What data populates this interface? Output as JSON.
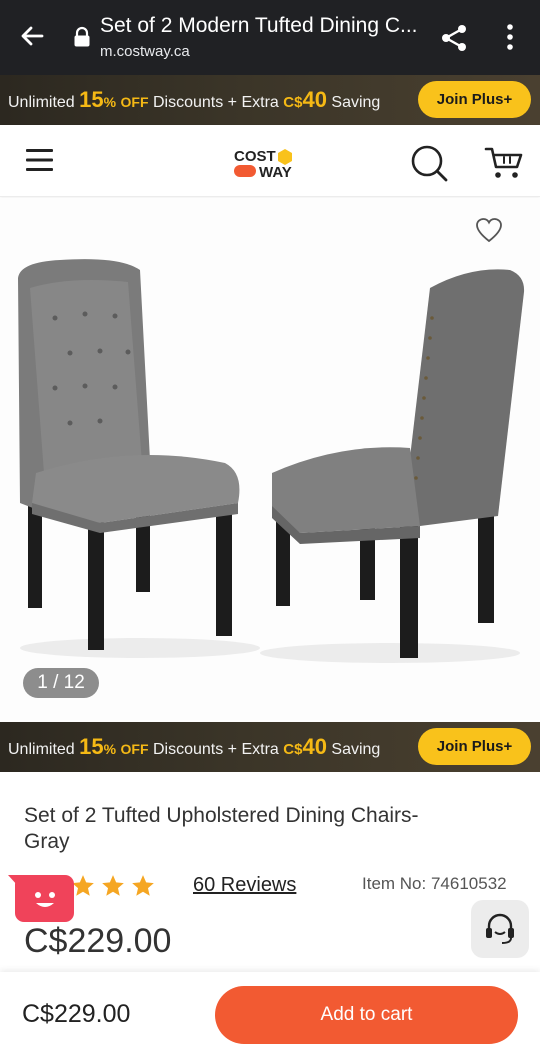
{
  "browser": {
    "title": "Set of 2 Modern Tufted Dining C...",
    "url": "m.costway.ca"
  },
  "promo": {
    "text_unlimited": "Unlimited",
    "percent": "15",
    "percent_suffix": "%",
    "off": "OFF",
    "text_discounts": "Discounts + Extra",
    "currency": "C$",
    "amount": "40",
    "text_saving": "Saving",
    "join_label": "Join Plus+"
  },
  "header": {
    "logo_line1": "COST",
    "logo_line2": "WAY"
  },
  "gallery": {
    "counter": "1 / 12"
  },
  "product": {
    "title": "Set of 2 Tufted Upholstered Dining Chairs-Gray",
    "rating_value": 5,
    "reviews": "60 Reviews",
    "item_no": "Item No: 74610532",
    "price": "C$229.00"
  },
  "bottom_bar": {
    "price": "C$229.00",
    "add_to_cart": "Add to cart"
  },
  "colors": {
    "accent": "#f25a32",
    "star": "#f5a623",
    "join_button": "#f9c21b",
    "promo_highlight": "#f5b915"
  }
}
